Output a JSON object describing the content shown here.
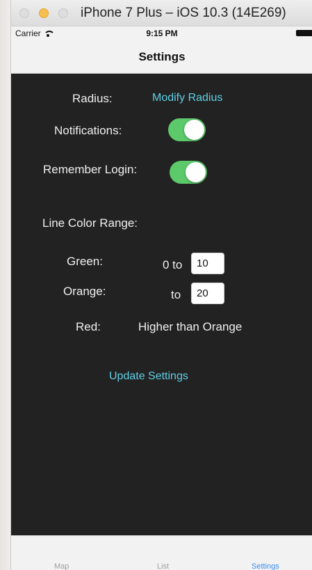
{
  "window": {
    "title": "iPhone 7 Plus – iOS 10.3 (14E269)"
  },
  "statusbar": {
    "carrier": "Carrier",
    "time": "9:15 PM"
  },
  "navbar": {
    "title": "Settings"
  },
  "settings": {
    "radius_label": "Radius:",
    "radius_link": "Modify Radius",
    "notifications_label": "Notifications:",
    "notifications_on": true,
    "remember_login_label": "Remember Login:",
    "remember_login_on": true,
    "line_color_range_label": "Line Color Range:",
    "green_label": "Green:",
    "green_prefix": "0 to",
    "green_value": "10",
    "orange_label": "Orange:",
    "orange_prefix": "to",
    "orange_value": "20",
    "red_label": "Red:",
    "red_value": "Higher than Orange",
    "update_button": "Update Settings"
  },
  "tabbar": {
    "tabs": [
      {
        "label": "Map",
        "active": false
      },
      {
        "label": "List",
        "active": false
      },
      {
        "label": "Settings",
        "active": true
      }
    ]
  },
  "colors": {
    "accent_link": "#5fd0e5",
    "switch_on": "#5cc96b",
    "tab_active": "#3a8ef0",
    "background": "#222222"
  }
}
